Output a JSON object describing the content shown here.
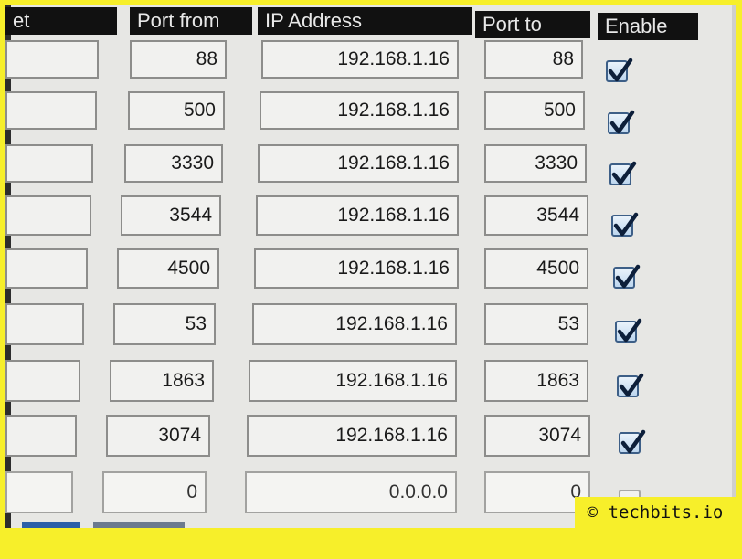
{
  "table": {
    "headers": {
      "col0": "et",
      "port_from": "Port from",
      "ip_address": "IP Address",
      "port_to": "Port to",
      "enable": "Enable"
    },
    "rows": [
      {
        "port_from": "88",
        "ip": "192.168.1.16",
        "port_to": "88",
        "enabled": true
      },
      {
        "port_from": "500",
        "ip": "192.168.1.16",
        "port_to": "500",
        "enabled": true
      },
      {
        "port_from": "3330",
        "ip": "192.168.1.16",
        "port_to": "3330",
        "enabled": true
      },
      {
        "port_from": "3544",
        "ip": "192.168.1.16",
        "port_to": "3544",
        "enabled": true
      },
      {
        "port_from": "4500",
        "ip": "192.168.1.16",
        "port_to": "4500",
        "enabled": true
      },
      {
        "port_from": "53",
        "ip": "192.168.1.16",
        "port_to": "53",
        "enabled": true
      },
      {
        "port_from": "1863",
        "ip": "192.168.1.16",
        "port_to": "1863",
        "enabled": true
      },
      {
        "port_from": "3074",
        "ip": "192.168.1.16",
        "port_to": "3074",
        "enabled": true
      },
      {
        "port_from": "0",
        "ip": "0.0.0.0",
        "port_to": "0",
        "enabled": false
      }
    ]
  },
  "watermark": "© techbits.io",
  "colors": {
    "frame": "#f7ef2a",
    "header_bg": "#111111",
    "checkbox_check": "#0d1f3a"
  }
}
